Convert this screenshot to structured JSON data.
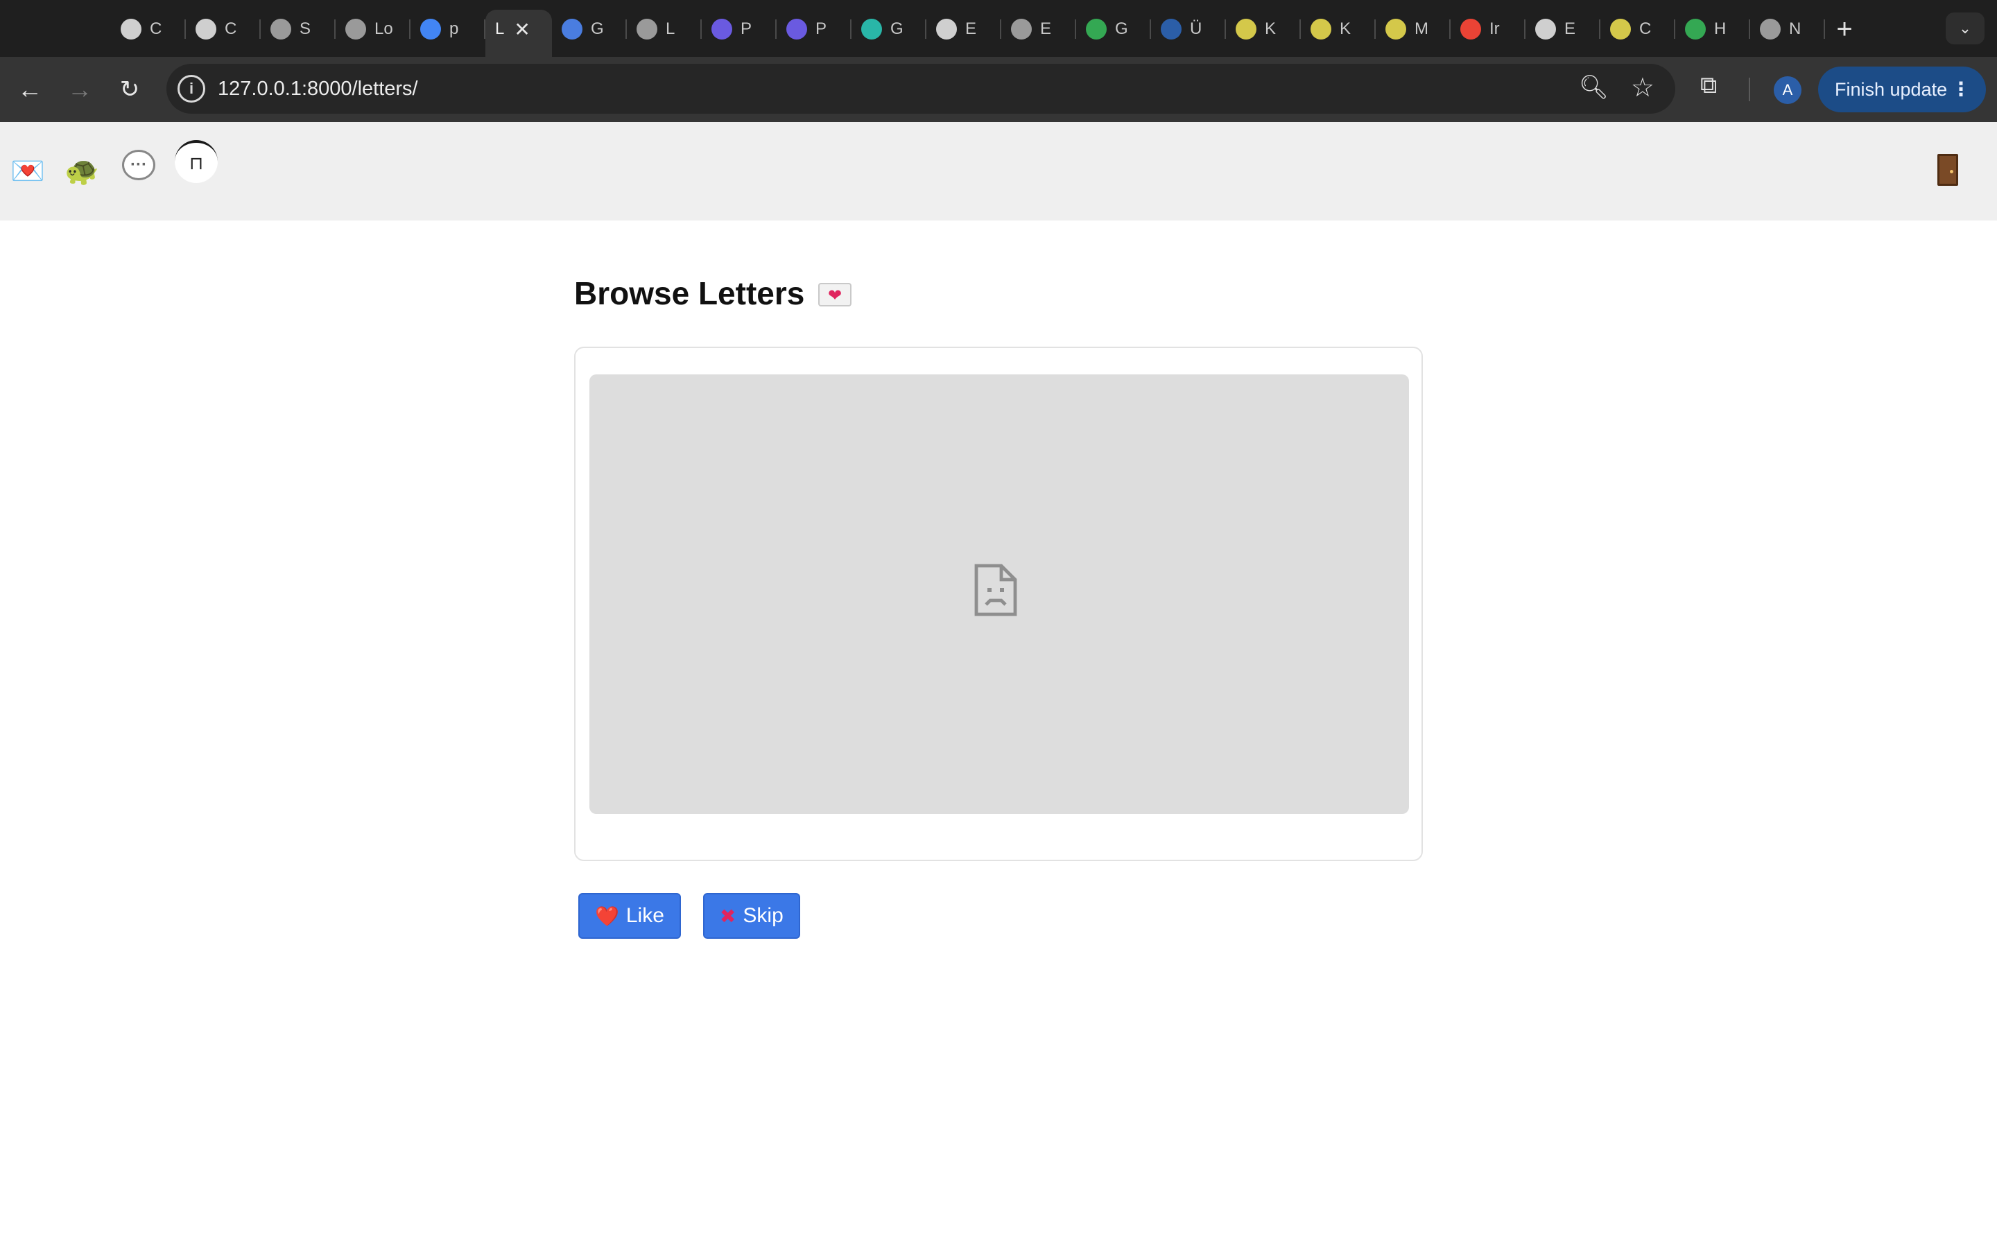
{
  "browser": {
    "tabs": [
      {
        "label": "C",
        "icon": "openai-icon",
        "color": "#cfcfcf"
      },
      {
        "label": "C",
        "icon": "openai-icon",
        "color": "#cfcfcf"
      },
      {
        "label": "S",
        "icon": "globe-icon",
        "color": "#9a9a9a"
      },
      {
        "label": "Lo",
        "icon": "globe-icon",
        "color": "#9a9a9a"
      },
      {
        "label": "p",
        "icon": "google-icon",
        "color": "#4285f4"
      },
      {
        "label": "L",
        "icon": "page-icon",
        "color": "#353535",
        "active": true
      },
      {
        "label": "G",
        "icon": "translate-icon",
        "color": "#4a7de0"
      },
      {
        "label": "L",
        "icon": "globe-icon",
        "color": "#9a9a9a"
      },
      {
        "label": "P",
        "icon": "s-icon",
        "color": "#6a5ae0"
      },
      {
        "label": "P",
        "icon": "s-icon",
        "color": "#6a5ae0"
      },
      {
        "label": "G",
        "icon": "swirl-icon",
        "color": "#29b6a8"
      },
      {
        "label": "E",
        "icon": "openai-icon",
        "color": "#cfcfcf"
      },
      {
        "label": "E",
        "icon": "globe-icon",
        "color": "#9a9a9a"
      },
      {
        "label": "G",
        "icon": "maps-icon",
        "color": "#34a853"
      },
      {
        "label": "Ü",
        "icon": "link-icon",
        "color": "#2b5ea8"
      },
      {
        "label": "K",
        "icon": "ticket-icon",
        "color": "#d4c84a"
      },
      {
        "label": "K",
        "icon": "ticket-icon",
        "color": "#d4c84a"
      },
      {
        "label": "M",
        "icon": "ticket-icon",
        "color": "#d4c84a"
      },
      {
        "label": "Ir",
        "icon": "gmail-icon",
        "color": "#ea4335"
      },
      {
        "label": "E",
        "icon": "openai-icon",
        "color": "#cfcfcf"
      },
      {
        "label": "C",
        "icon": "ticket-icon",
        "color": "#d4c84a"
      },
      {
        "label": "H",
        "icon": "maps-icon",
        "color": "#34a853"
      },
      {
        "label": "N",
        "icon": "chrome-icon",
        "color": "#9a9a9a"
      }
    ],
    "url": "127.0.0.1:8000/letters/",
    "finish_update_label": "Finish update",
    "avatar_letter": "A"
  },
  "app": {
    "nav": {
      "mail_icon": "💌",
      "turtle_icon": "🐢",
      "chat_icon": "💬"
    },
    "title": "Browse Letters",
    "actions": {
      "like_emoji": "❤️",
      "like_label": "Like",
      "skip_emoji": "✖",
      "skip_label": "Skip"
    }
  }
}
